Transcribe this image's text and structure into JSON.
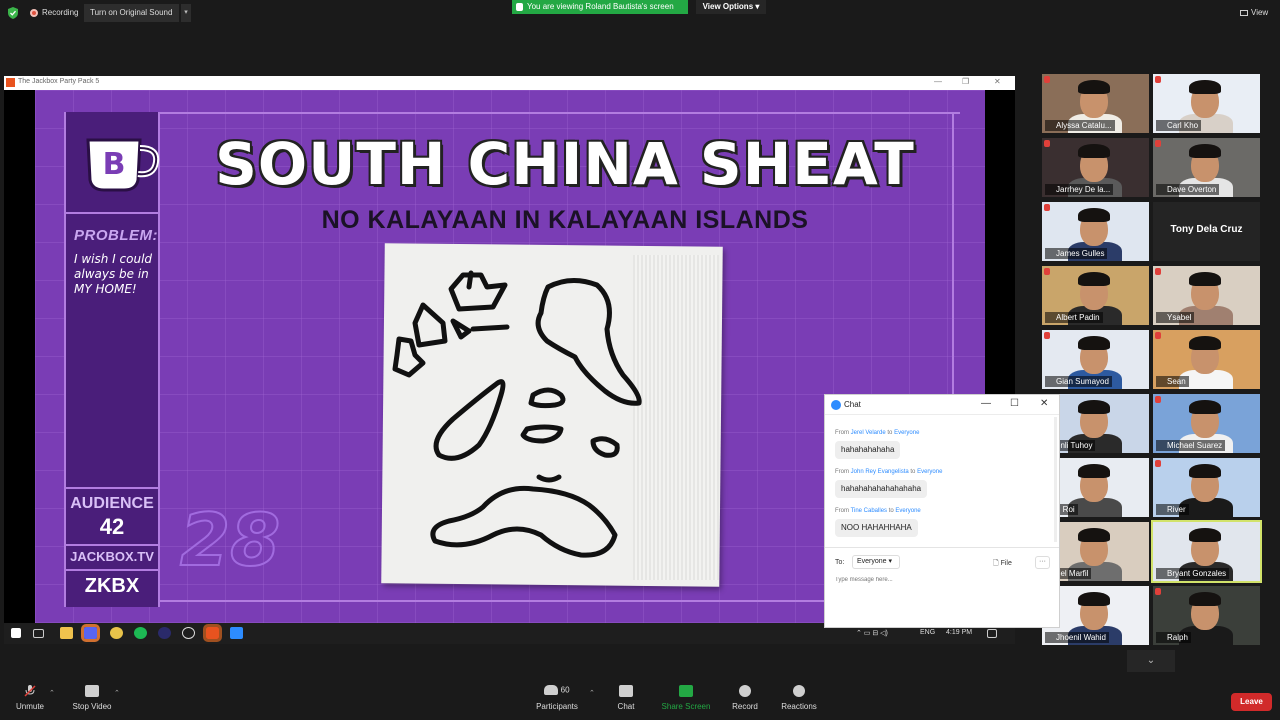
{
  "top_bar": {
    "recording_label": "Recording",
    "original_sound_label": "Turn on Original Sound",
    "viewing_label": "You are viewing Roland Bautista's screen",
    "view_options_label": "View Options",
    "view_label": "View"
  },
  "shared_window": {
    "title": "The Jackbox Party Pack 5"
  },
  "game": {
    "mug_letter": "B",
    "title": "SOUTH CHINA SHEAT",
    "subtitle": "NO KALAYAAN IN KALAYAAN ISLANDS",
    "problem_label": "PROBLEM:",
    "problem_text": "I wish I could always be in MY HOME!",
    "audience_label": "AUDIENCE",
    "audience_count": "42",
    "site": "JACKBOX.TV",
    "room_code": "ZKBX",
    "timer": "28"
  },
  "taskbar": {
    "lang": "ENG",
    "time": "4:19 PM"
  },
  "participants": [
    {
      "name": "Alyssa Catalu...",
      "muted": true
    },
    {
      "name": "Carl Kho",
      "muted": true
    },
    {
      "name": "Jarrhey De la...",
      "muted": true
    },
    {
      "name": "Dave Overton",
      "muted": true
    },
    {
      "name": "James Gulles",
      "muted": true
    },
    {
      "name": "Tony Dela Cruz",
      "muted": false,
      "video_off": true
    },
    {
      "name": "Albert Padin",
      "muted": true
    },
    {
      "name": "Ysabel",
      "muted": true
    },
    {
      "name": "Gian Sumayod",
      "muted": true
    },
    {
      "name": "Sean",
      "muted": true
    },
    {
      "name": "enli Tuhoy",
      "muted": false
    },
    {
      "name": "Michael Suarez",
      "muted": true
    },
    {
      "name": "d Roi",
      "muted": false
    },
    {
      "name": "River",
      "muted": true
    },
    {
      "name": "nel Marfil",
      "muted": false
    },
    {
      "name": "Bryant Gonzales",
      "muted": false,
      "active": true
    },
    {
      "name": "Jhoenil Wahid",
      "muted": false
    },
    {
      "name": "Ralph",
      "muted": true
    }
  ],
  "chat": {
    "title": "Chat",
    "messages": [
      {
        "from_prefix": "From",
        "sender": "Jerel Velarde",
        "to_word": "to",
        "recipient": "Everyone",
        "text": "hahahahahaha"
      },
      {
        "from_prefix": "From",
        "sender": "John Rey Evangelista",
        "to_word": "to",
        "recipient": "Everyone",
        "text": "hahahahahahahahaha"
      },
      {
        "from_prefix": "From",
        "sender": "Tine Caballes",
        "to_word": "to",
        "recipient": "Everyone",
        "text": "NOO HAHAHHAHA"
      }
    ],
    "to_label": "To:",
    "recipient_selected": "Everyone",
    "file_label": "File",
    "input_placeholder": "Type message here..."
  },
  "toolbar": {
    "unmute": "Unmute",
    "stop_video": "Stop Video",
    "participants": "Participants",
    "participants_count": "60",
    "chat": "Chat",
    "share_screen": "Share Screen",
    "record": "Record",
    "reactions": "Reactions",
    "leave": "Leave"
  },
  "colors": {
    "share_green": "#23a844",
    "game_purple": "#7a3db5",
    "leave_red": "#d12a2a",
    "active_speaker": "#d2e36a"
  }
}
